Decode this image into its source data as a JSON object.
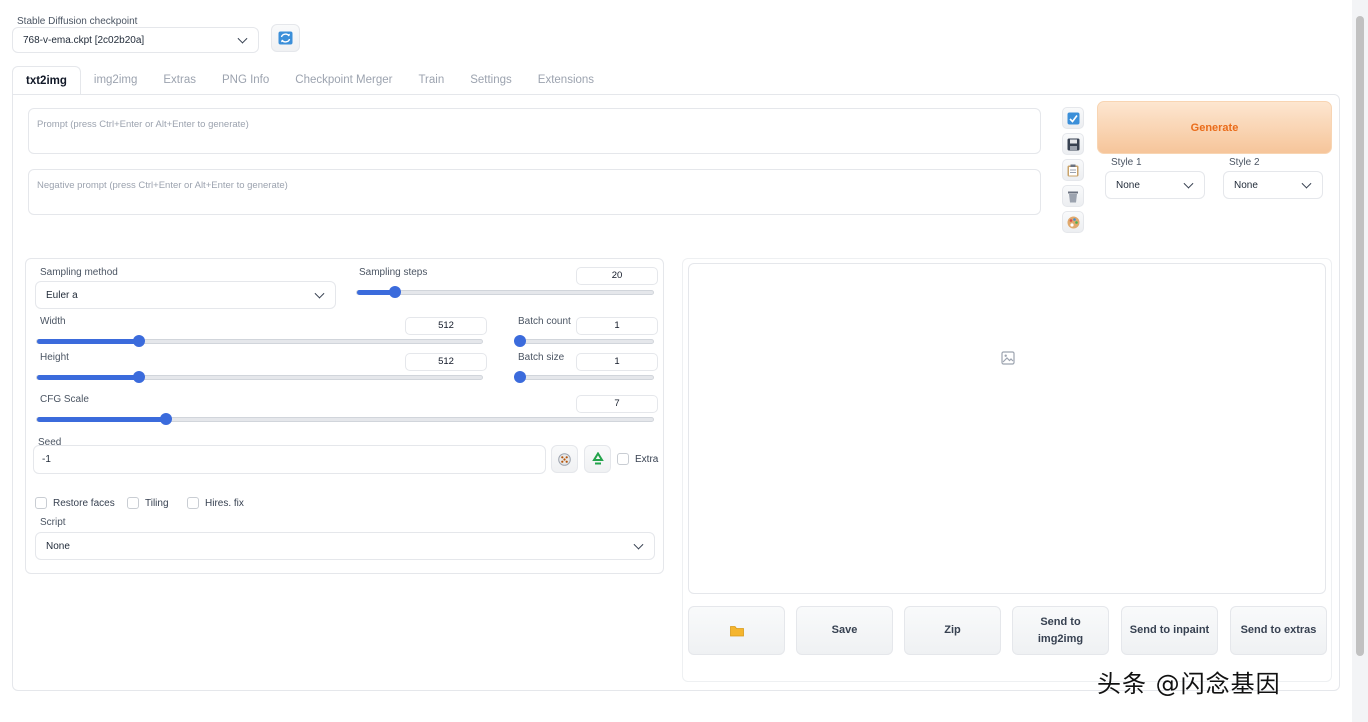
{
  "checkpoint": {
    "label": "Stable Diffusion checkpoint",
    "value": "768-v-ema.ckpt [2c02b20a]",
    "refresh_icon": "refresh-icon"
  },
  "tabs": [
    {
      "label": "txt2img",
      "active": true
    },
    {
      "label": "img2img"
    },
    {
      "label": "Extras"
    },
    {
      "label": "PNG Info"
    },
    {
      "label": "Checkpoint Merger"
    },
    {
      "label": "Train"
    },
    {
      "label": "Settings"
    },
    {
      "label": "Extensions"
    }
  ],
  "prompt": {
    "placeholder": "Prompt (press Ctrl+Enter or Alt+Enter to generate)"
  },
  "negative_prompt": {
    "placeholder": "Negative prompt (press Ctrl+Enter or Alt+Enter to generate)"
  },
  "tools": [
    "check-icon",
    "save-icon",
    "clipboard-icon",
    "trash-icon",
    "palette-icon"
  ],
  "generate": {
    "label": "Generate"
  },
  "styles": {
    "style1": {
      "label": "Style 1",
      "value": "None"
    },
    "style2": {
      "label": "Style 2",
      "value": "None"
    }
  },
  "settings": {
    "sampling_method": {
      "label": "Sampling method",
      "value": "Euler a"
    },
    "sampling_steps": {
      "label": "Sampling steps",
      "value": "20",
      "fraction": 0.13
    },
    "width": {
      "label": "Width",
      "value": "512",
      "fraction": 0.23
    },
    "height": {
      "label": "Height",
      "value": "512",
      "fraction": 0.23
    },
    "batch_count": {
      "label": "Batch count",
      "value": "1",
      "fraction": 0.0
    },
    "batch_size": {
      "label": "Batch size",
      "value": "1",
      "fraction": 0.0
    },
    "cfg_scale": {
      "label": "CFG Scale",
      "value": "7",
      "fraction": 0.21
    },
    "seed": {
      "label": "Seed",
      "value": "-1",
      "extra_label": "Extra"
    },
    "restore_faces": "Restore faces",
    "tiling": "Tiling",
    "hires_fix": "Hires. fix",
    "script": {
      "label": "Script",
      "value": "None"
    }
  },
  "output": {
    "image_icon": "image-icon",
    "buttons": {
      "folder": "folder-icon",
      "save": "Save",
      "zip": "Zip",
      "send_img2img_1": "Send to",
      "send_img2img_2": "img2img",
      "send_inpaint": "Send to inpaint",
      "send_extras": "Send to extras"
    }
  },
  "watermark": "头条 @闪念基因"
}
